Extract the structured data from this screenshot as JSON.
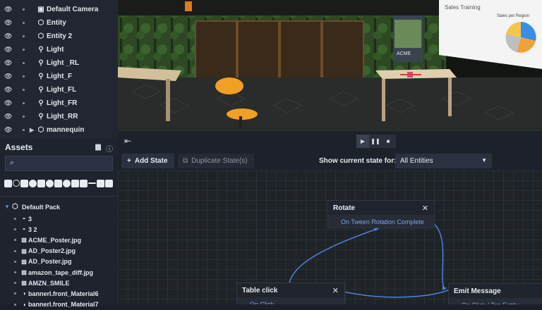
{
  "hierarchy": {
    "items": [
      {
        "label": "Default Camera",
        "icon": "camera-icon"
      },
      {
        "label": "Entity",
        "icon": "entity-icon"
      },
      {
        "label": "Entity 2",
        "icon": "entity-icon"
      },
      {
        "label": "Light",
        "icon": "light-icon"
      },
      {
        "label": "Light _RL",
        "icon": "light-icon"
      },
      {
        "label": "Light_F",
        "icon": "light-icon"
      },
      {
        "label": "Light_FL",
        "icon": "light-icon"
      },
      {
        "label": "Light_FR",
        "icon": "light-icon"
      },
      {
        "label": "Light_RR",
        "icon": "light-icon"
      },
      {
        "label": "mannequin",
        "icon": "entity-icon"
      }
    ]
  },
  "assets": {
    "title": "Assets",
    "search": {
      "value": "",
      "placeholder": ""
    },
    "pack": "Default Pack",
    "items": [
      {
        "label": "3",
        "icon": "entity-icon"
      },
      {
        "label": "3 2",
        "icon": "entity-icon"
      },
      {
        "label": "ACME_Poster.jpg",
        "icon": "image-icon"
      },
      {
        "label": "AD_Poster2.jpg",
        "icon": "image-icon"
      },
      {
        "label": "AD_Poster.jpg",
        "icon": "image-icon"
      },
      {
        "label": "amazon_tape_diff.jpg",
        "icon": "image-icon"
      },
      {
        "label": "AMZN_SMILE",
        "icon": "image-icon"
      },
      {
        "label": "bannerl.front_Material6",
        "icon": "material-icon"
      },
      {
        "label": "bannerl.front_Material7",
        "icon": "material-icon"
      }
    ]
  },
  "viewport": {
    "poster_title": "Sales Training",
    "chart_title": "Sales per Region",
    "logo_text": "ACME",
    "colors": {
      "sky": "#1a1d18",
      "floor": "#2b2d2c",
      "glass": "#3a5a2a",
      "chair": "#f0a024",
      "table": "#d6c3a0"
    }
  },
  "playback": {
    "play": "▶",
    "pause": "❚❚",
    "stop": "■"
  },
  "toolbar": {
    "add_state": "Add State",
    "duplicate_state": "Duplicate State(s)",
    "show_label": "Show current state for:",
    "entity_select": "All Entities"
  },
  "graph": {
    "nodes": {
      "rotate": {
        "title": "Rotate",
        "event": "On Tween Rotation Complete"
      },
      "table_click": {
        "title": "Table click",
        "event": "On Click"
      },
      "emit_message": {
        "title": "Emit Message",
        "event": "On Click / Tap Entity"
      }
    },
    "link_color": "#4a82d9"
  }
}
